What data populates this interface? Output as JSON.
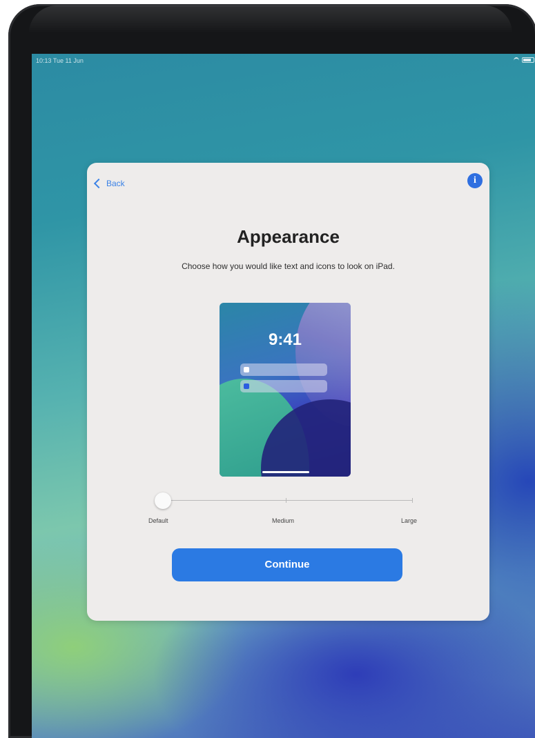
{
  "status_bar": {
    "time": "10:13  Tue 11 Jun",
    "battery_icon": "battery-icon",
    "wifi_icon": "wifi-icon"
  },
  "card": {
    "back_label": "Back",
    "info_icon_glyph": "i",
    "title": "Appearance",
    "subtitle": "Choose how you would like text and icons to look on iPad.",
    "preview": {
      "time": "9:41"
    },
    "slider": {
      "labels": [
        "Default",
        "Medium",
        "Large"
      ],
      "selected": "Default",
      "value": 0
    },
    "continue_label": "Continue"
  },
  "colors": {
    "accent": "#2b7ae3",
    "card_background": "#eeeceb"
  }
}
